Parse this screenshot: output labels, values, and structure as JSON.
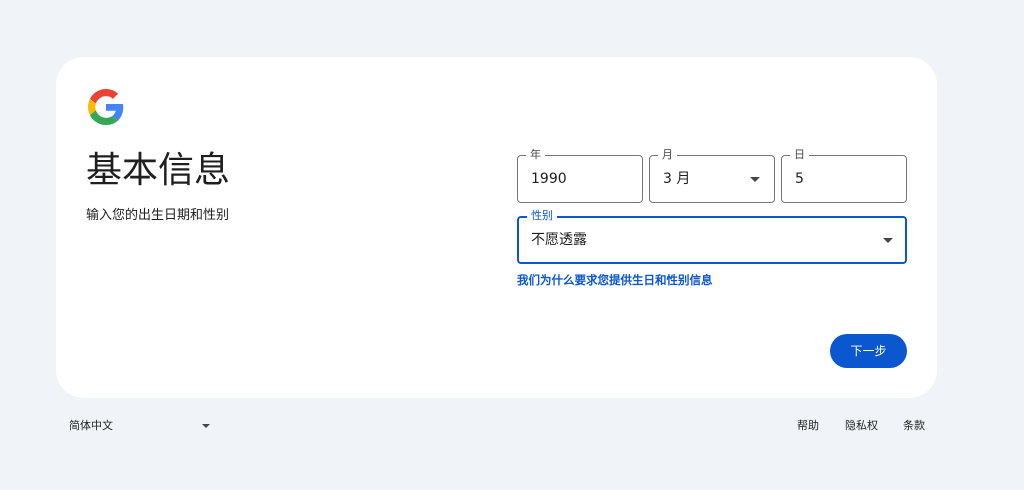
{
  "card": {
    "title": "基本信息",
    "subtitle": "输入您的出生日期和性别"
  },
  "birthdate": {
    "year": {
      "label": "年",
      "value": "1990"
    },
    "month": {
      "label": "月",
      "value": "3 月"
    },
    "day": {
      "label": "日",
      "value": "5"
    }
  },
  "gender": {
    "label": "性别",
    "value": "不愿透露"
  },
  "why_link": "我们为什么要求您提供生日和性别信息",
  "next_button": "下一步",
  "footer": {
    "language": "简体中文",
    "links": {
      "help": "帮助",
      "privacy": "隐私权",
      "terms": "条款"
    }
  },
  "colors": {
    "page_background": "#f0f4f8",
    "card_background": "#ffffff",
    "accent": "#0b57d0",
    "text": "#1f1f1f",
    "outline": "#747775"
  },
  "icons": {
    "logo": "google-g-logo",
    "dropdown": "caret-down-icon"
  }
}
